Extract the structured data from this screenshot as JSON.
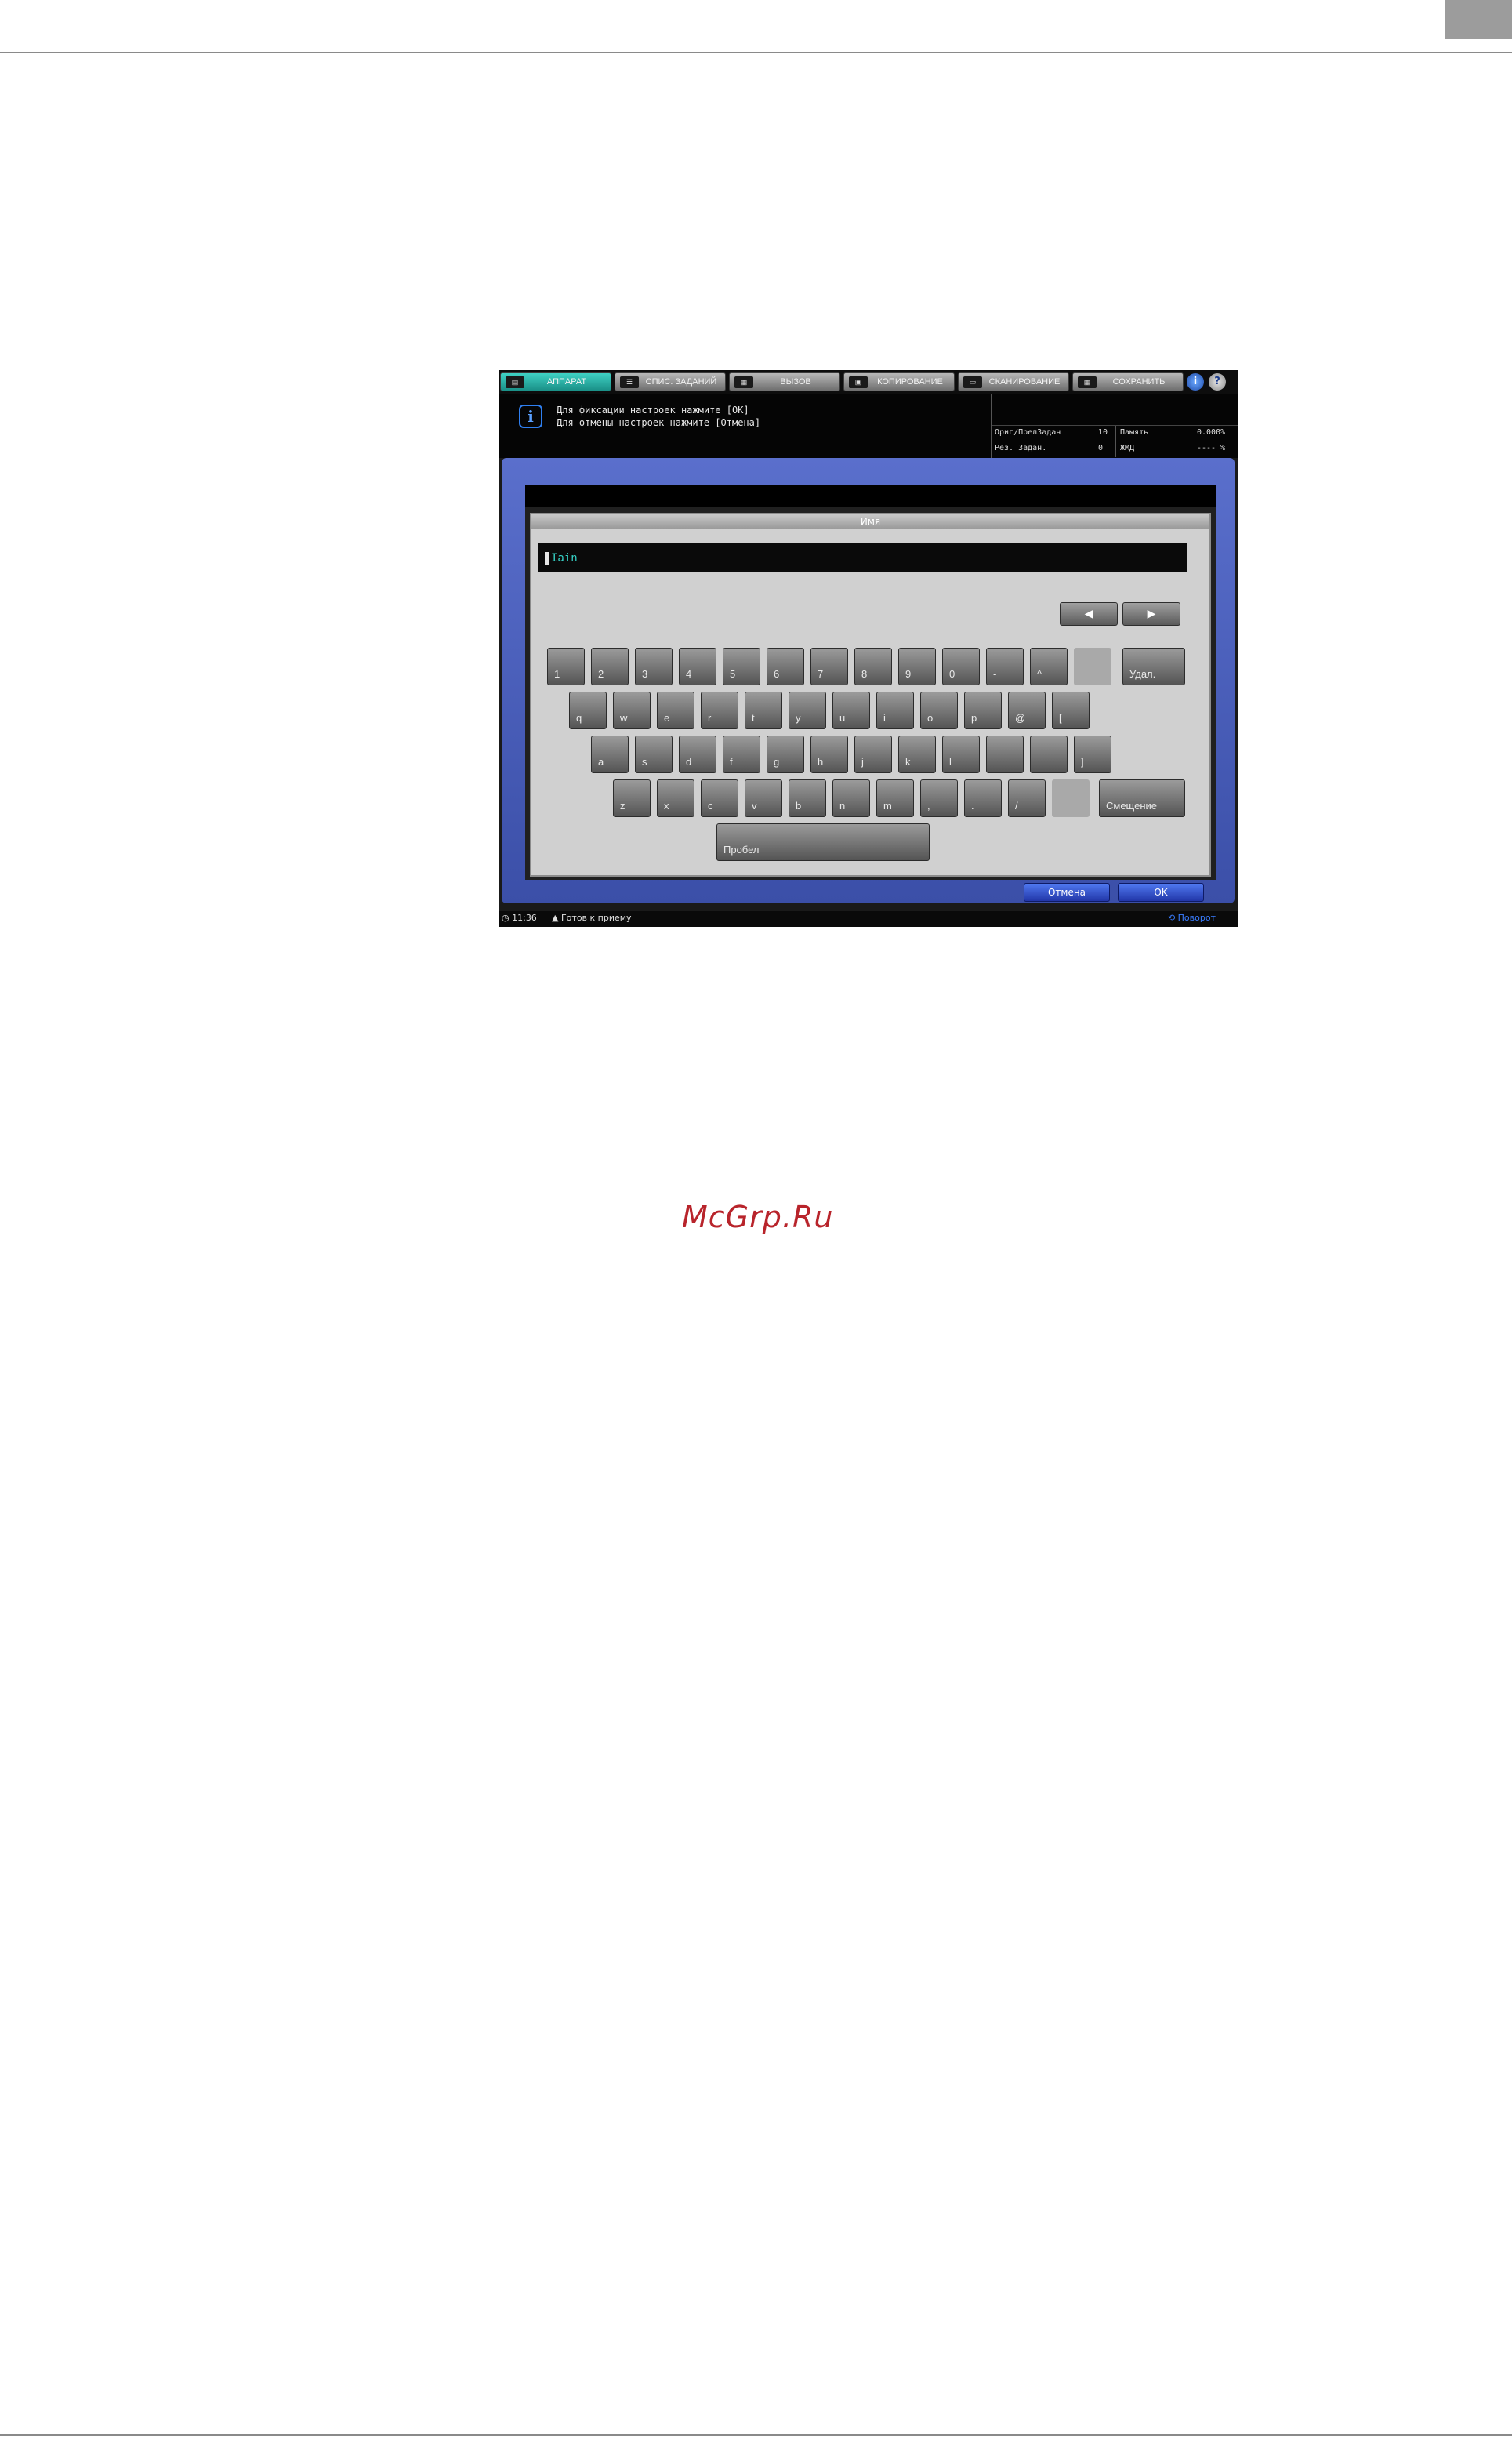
{
  "page": {
    "watermark": "McGrp.Ru"
  },
  "tabs": [
    {
      "label": "АППАРАТ",
      "icon": "machine-icon",
      "active": true
    },
    {
      "label": "СПИС. ЗАДАНИЙ",
      "icon": "list-icon",
      "active": false
    },
    {
      "label": "ВЫЗОВ",
      "icon": "recall-icon",
      "active": false
    },
    {
      "label": "КОПИРОВАНИЕ",
      "icon": "copy-icon",
      "active": false
    },
    {
      "label": "СКАНИРОВАНИЕ",
      "icon": "scan-icon",
      "active": false
    },
    {
      "label": "СОХРАНИТЬ",
      "icon": "store-icon",
      "active": false
    }
  ],
  "header_buttons": {
    "info_glyph": "i",
    "help_glyph": "?"
  },
  "message": {
    "line1": "Для фиксации настроек нажмите [OK]",
    "line2": "Для отмены настроек нажмите [Отмена]"
  },
  "status": {
    "orig_label": "Ориг/ПрелЗадан",
    "orig_value": "10",
    "memory_label": "Память",
    "memory_value": "0.000%",
    "reserved_label": "Рез. Задан.",
    "reserved_value": "0",
    "hdd_label": "ЖМД",
    "hdd_value": "---- %"
  },
  "dialog": {
    "title": "Имя",
    "name_value": "Iain",
    "arrow_left": "◀",
    "arrow_right": "▶"
  },
  "keyboard": {
    "row1": [
      "1",
      "2",
      "3",
      "4",
      "5",
      "6",
      "7",
      "8",
      "9",
      "0",
      "-",
      "^",
      ""
    ],
    "row2": [
      "q",
      "w",
      "e",
      "r",
      "t",
      "y",
      "u",
      "i",
      "o",
      "p",
      "@",
      "["
    ],
    "row3": [
      "a",
      "s",
      "d",
      "f",
      "g",
      "h",
      "j",
      "k",
      "l",
      "",
      "",
      "]"
    ],
    "row4": [
      "z",
      "x",
      "c",
      "v",
      "b",
      "n",
      "m",
      ",",
      ".",
      "/",
      ""
    ],
    "delete_label": "Удал.",
    "shift_label": "Смещение",
    "space_label": "Пробел"
  },
  "buttons": {
    "cancel": "Отмена",
    "ok": "OK"
  },
  "statusbar": {
    "time": "11:36",
    "ready": "Готов к приему",
    "rotate": "Поворот"
  }
}
